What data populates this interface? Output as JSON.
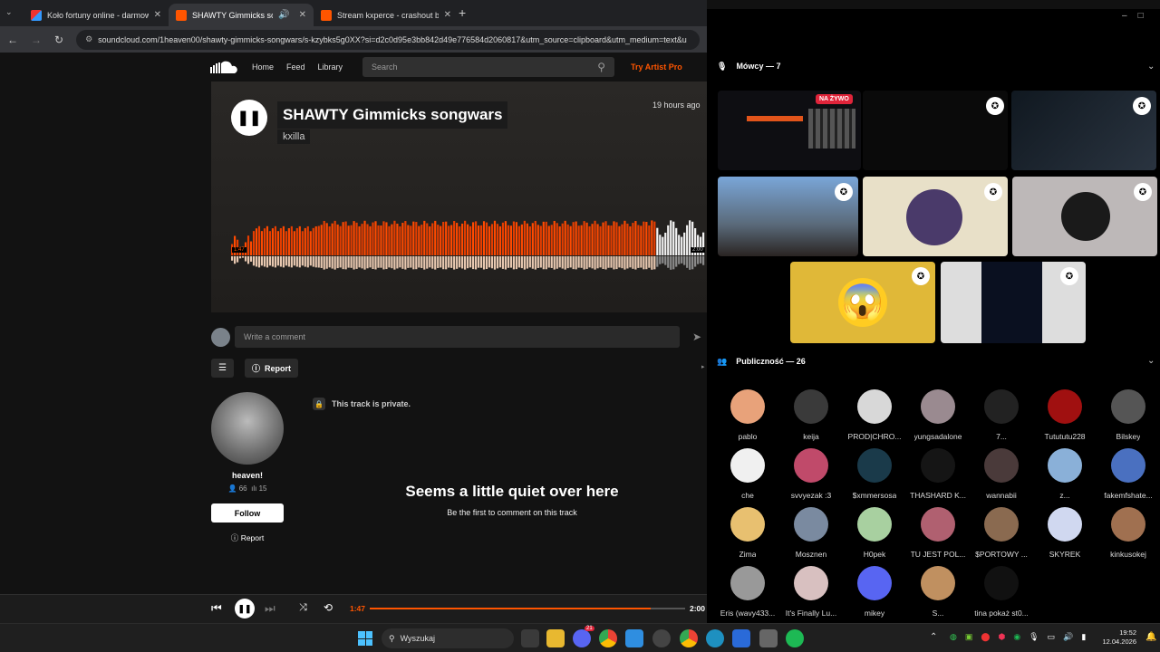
{
  "browser": {
    "tabs": [
      {
        "title": "Koło fortuny online - darmowe",
        "favicon_color": "#3b6fd8"
      },
      {
        "title": "SHAWTY Gimmicks songwars",
        "favicon_color": "#ff5500"
      },
      {
        "title": "Stream kxperce - crashout by k",
        "favicon_color": "#ff5500"
      }
    ],
    "url": "soundcloud.com/1heaven00/shawty-gimmicks-songwars/s-kzybks5g0XX?si=d2c0d95e3bb842d49e776584d2060817&utm_source=clipboard&utm_medium=text&u"
  },
  "soundcloud": {
    "nav": {
      "home": "Home",
      "feed": "Feed",
      "library": "Library",
      "search_placeholder": "Search",
      "try_pro": "Try Artist Pro"
    },
    "track": {
      "title": "SHAWTY Gimmicks songwars",
      "artist": "kxilla",
      "posted": "19 hours ago",
      "elapsed": "1:47",
      "duration": "2:00",
      "progress": 0.892
    },
    "comment_placeholder": "Write a comment",
    "report": "Report",
    "private_notice": "This track is private.",
    "uploader": {
      "name": "heaven!",
      "followers": "66",
      "tracks": "15",
      "follow": "Follow",
      "report": "Report"
    },
    "empty_title": "Seems a little quiet over here",
    "empty_sub": "Be the first to comment on this track",
    "player": {
      "elapsed": "1:47",
      "duration": "2:00",
      "progress": 0.892
    }
  },
  "discord": {
    "speakers_label": "Mówcy — 7",
    "live_label": "NA ŻYWO",
    "audience_label": "Publiczność — 26",
    "audience": [
      {
        "name": "pablo",
        "color": "#e8a27a"
      },
      {
        "name": "keija",
        "color": "#3a3a3a"
      },
      {
        "name": "PROD|CHRO...",
        "color": "#d8d8d8"
      },
      {
        "name": "yungsadalone",
        "color": "#9a8a90"
      },
      {
        "name": "7...",
        "color": "#222"
      },
      {
        "name": "Tutututu228",
        "color": "#a01010"
      },
      {
        "name": "Bilskey",
        "color": "#555"
      },
      {
        "name": "che",
        "color": "#f0f0f0"
      },
      {
        "name": "svvyezak :3",
        "color": "#c04a6a"
      },
      {
        "name": "$xmmersosa",
        "color": "#1a3a4a"
      },
      {
        "name": "THASHARD K...",
        "color": "#151515"
      },
      {
        "name": "wannabii",
        "color": "#4a3a3a"
      },
      {
        "name": "z...",
        "color": "#8ab0d8"
      },
      {
        "name": "fakemfshate...",
        "color": "#4a70c0"
      },
      {
        "name": "Zima",
        "color": "#e8c070"
      },
      {
        "name": "Mosznen",
        "color": "#7a8aa0"
      },
      {
        "name": "H0pek",
        "color": "#a8d0a0"
      },
      {
        "name": "TU JEST POL...",
        "color": "#b06070"
      },
      {
        "name": "$PORTOWY ...",
        "color": "#8a6a50"
      },
      {
        "name": "SKYREK",
        "color": "#d0d8f0"
      },
      {
        "name": "kinkusokej",
        "color": "#a07050"
      },
      {
        "name": "Eris (wavy433...",
        "color": "#999"
      },
      {
        "name": "It's Finally Lu...",
        "color": "#d8c0c0"
      },
      {
        "name": "mikey",
        "color": "#5865f2"
      },
      {
        "name": "S...",
        "color": "#c09060"
      },
      {
        "name": "tina pokaż st0...",
        "color": "#111"
      }
    ]
  },
  "taskbar": {
    "search_placeholder": "Wyszukaj",
    "time": "19:52",
    "date": "12.04.2026",
    "discord_badge": "21"
  }
}
